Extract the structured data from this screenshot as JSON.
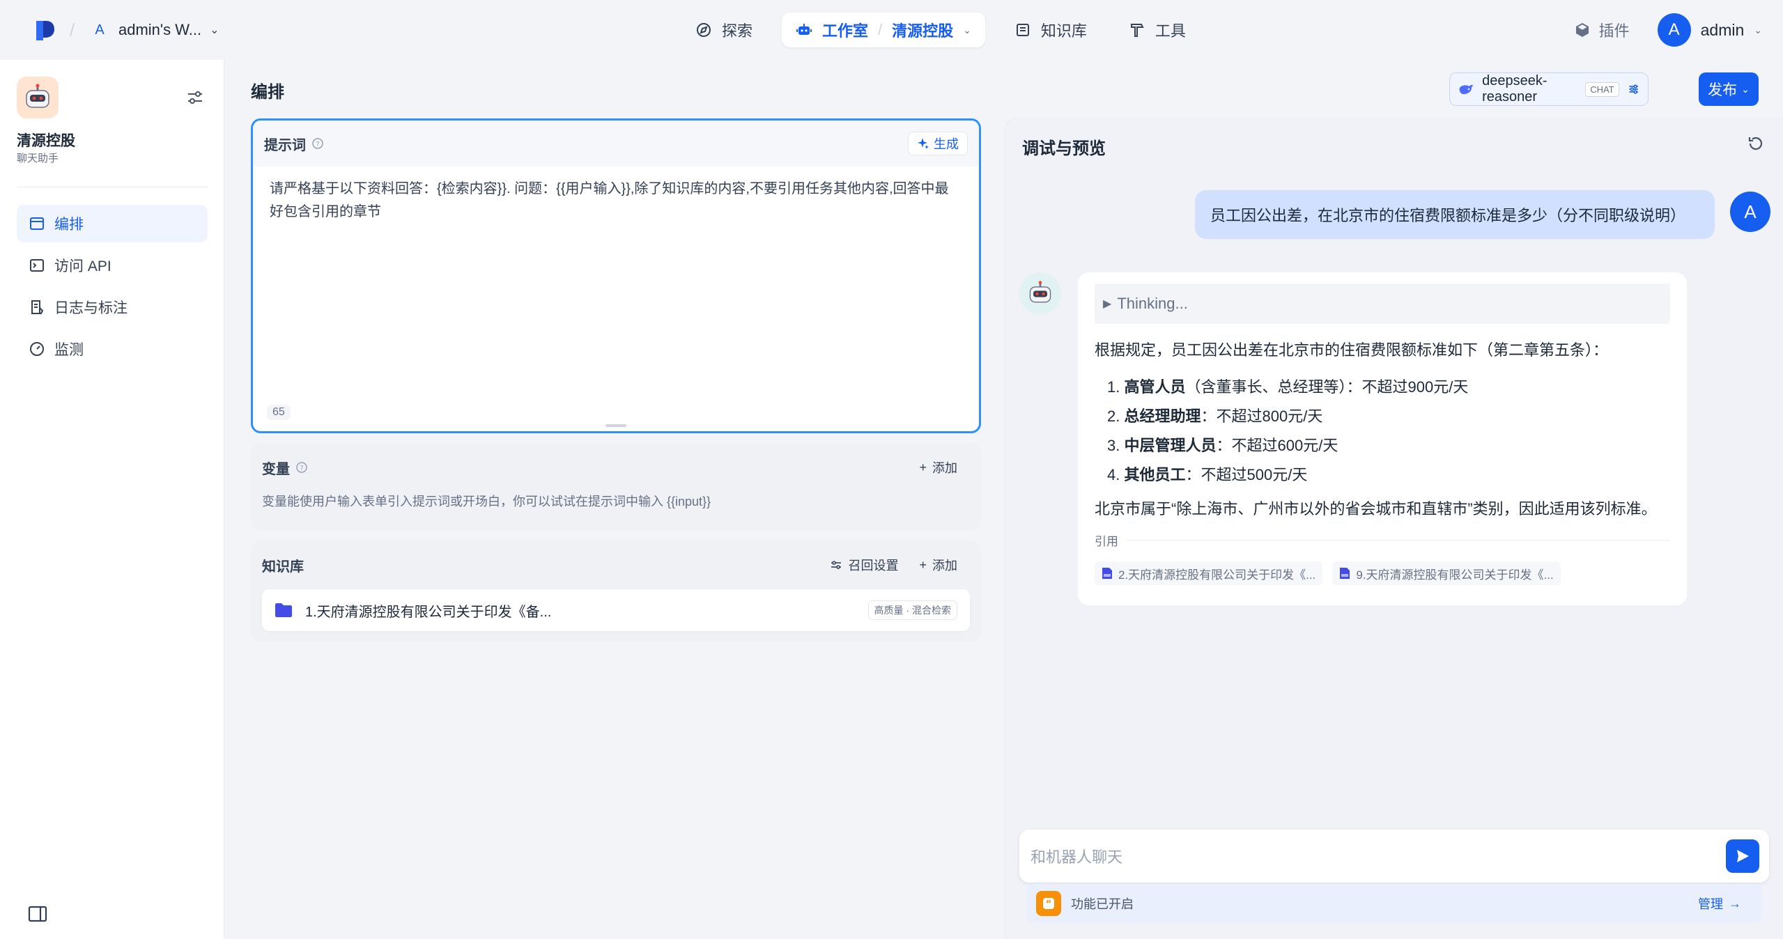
{
  "topbar": {
    "workspace_initial": "A",
    "workspace_name": "admin's W...",
    "nav": {
      "explore": "探索",
      "studio": "工作室",
      "current_app": "清源控股",
      "knowledge": "知识库",
      "tools": "工具"
    },
    "plugins": "插件",
    "user_initial": "A",
    "user_name": "admin"
  },
  "sidebar": {
    "app_name": "清源控股",
    "app_type": "聊天助手",
    "items": [
      {
        "label": "编排",
        "icon": "layout-icon",
        "active": true
      },
      {
        "label": "访问 API",
        "icon": "terminal-icon",
        "active": false
      },
      {
        "label": "日志与标注",
        "icon": "log-icon",
        "active": false
      },
      {
        "label": "监测",
        "icon": "gauge-icon",
        "active": false
      }
    ]
  },
  "orchestrate": {
    "title": "编排",
    "model_name": "deepseek-reasoner",
    "model_mode": "CHAT",
    "publish": "发布",
    "prompt": {
      "label": "提示词",
      "generate": "生成",
      "text": "请严格基于以下资料回答：{检索内容}}. 问题：{{用户输入}},除了知识库的内容,不要引用任务其他内容,回答中最好包含引用的章节",
      "char_count": "65"
    },
    "variables": {
      "label": "变量",
      "add": "添加",
      "desc": "变量能使用户输入表单引入提示词或开场白，你可以试试在提示词中输入 {{input}}"
    },
    "knowledge": {
      "label": "知识库",
      "recall": "召回设置",
      "add": "添加",
      "item_name": "1.天府清源控股有限公司关于印发《备...",
      "item_tag": "高质量 · 混合检索"
    }
  },
  "debug": {
    "title": "调试与预览",
    "user_initial": "A",
    "user_message": "员工因公出差，在北京市的住宿费限额标准是多少（分不同职级说明）",
    "thinking": "Thinking...",
    "answer_intro": "根据规定，员工因公出差在北京市的住宿费限额标准如下（第二章第五条）：",
    "answer_items": [
      {
        "num": "1.",
        "role": "高管人员",
        "detail": "（含董事长、总经理等）：不超过900元/天"
      },
      {
        "num": "2.",
        "role": "总经理助理",
        "detail": "：不超过800元/天"
      },
      {
        "num": "3.",
        "role": "中层管理人员",
        "detail": "：不超过600元/天"
      },
      {
        "num": "4.",
        "role": "其他员工",
        "detail": "：不超过500元/天"
      }
    ],
    "answer_outro": "北京市属于“除上海市、广州市以外的省会城市和直辖市”类别，因此适用该列标准。",
    "citation_label": "引用",
    "citations": [
      "2.天府清源控股有限公司关于印发《...",
      "9.天府清源控股有限公司关于印发《..."
    ],
    "input_placeholder": "和机器人聊天",
    "feature_text": "功能已开启",
    "manage": "管理"
  },
  "colors": {
    "accent": "#155eef",
    "user_bubble": "#d1e0ff",
    "feature_icon": "#f79009"
  }
}
